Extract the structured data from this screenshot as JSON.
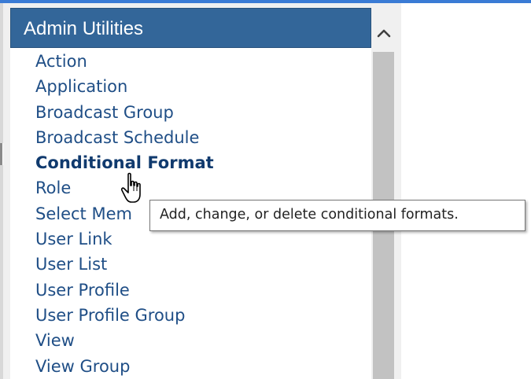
{
  "panel": {
    "title": "Admin Utilities",
    "items": [
      {
        "label": "Action"
      },
      {
        "label": "Application"
      },
      {
        "label": "Broadcast Group"
      },
      {
        "label": "Broadcast Schedule"
      },
      {
        "label": "Conditional Format",
        "state": "hover"
      },
      {
        "label": "Role"
      },
      {
        "label": "Select Mem"
      },
      {
        "label": "User Link"
      },
      {
        "label": "User List"
      },
      {
        "label": "User Profile"
      },
      {
        "label": "User Profile Group"
      },
      {
        "label": "View"
      },
      {
        "label": "View Group"
      }
    ]
  },
  "tooltip": {
    "text": "Add, change, or delete conditional formats."
  },
  "scrollbar": {
    "up_icon": "chevron-up-icon"
  },
  "cursor": {
    "icon": "hand-pointer-icon"
  },
  "colors": {
    "header_bg": "#336699",
    "link_text": "#1f4e86",
    "top_accent": "#3a7bd5"
  }
}
